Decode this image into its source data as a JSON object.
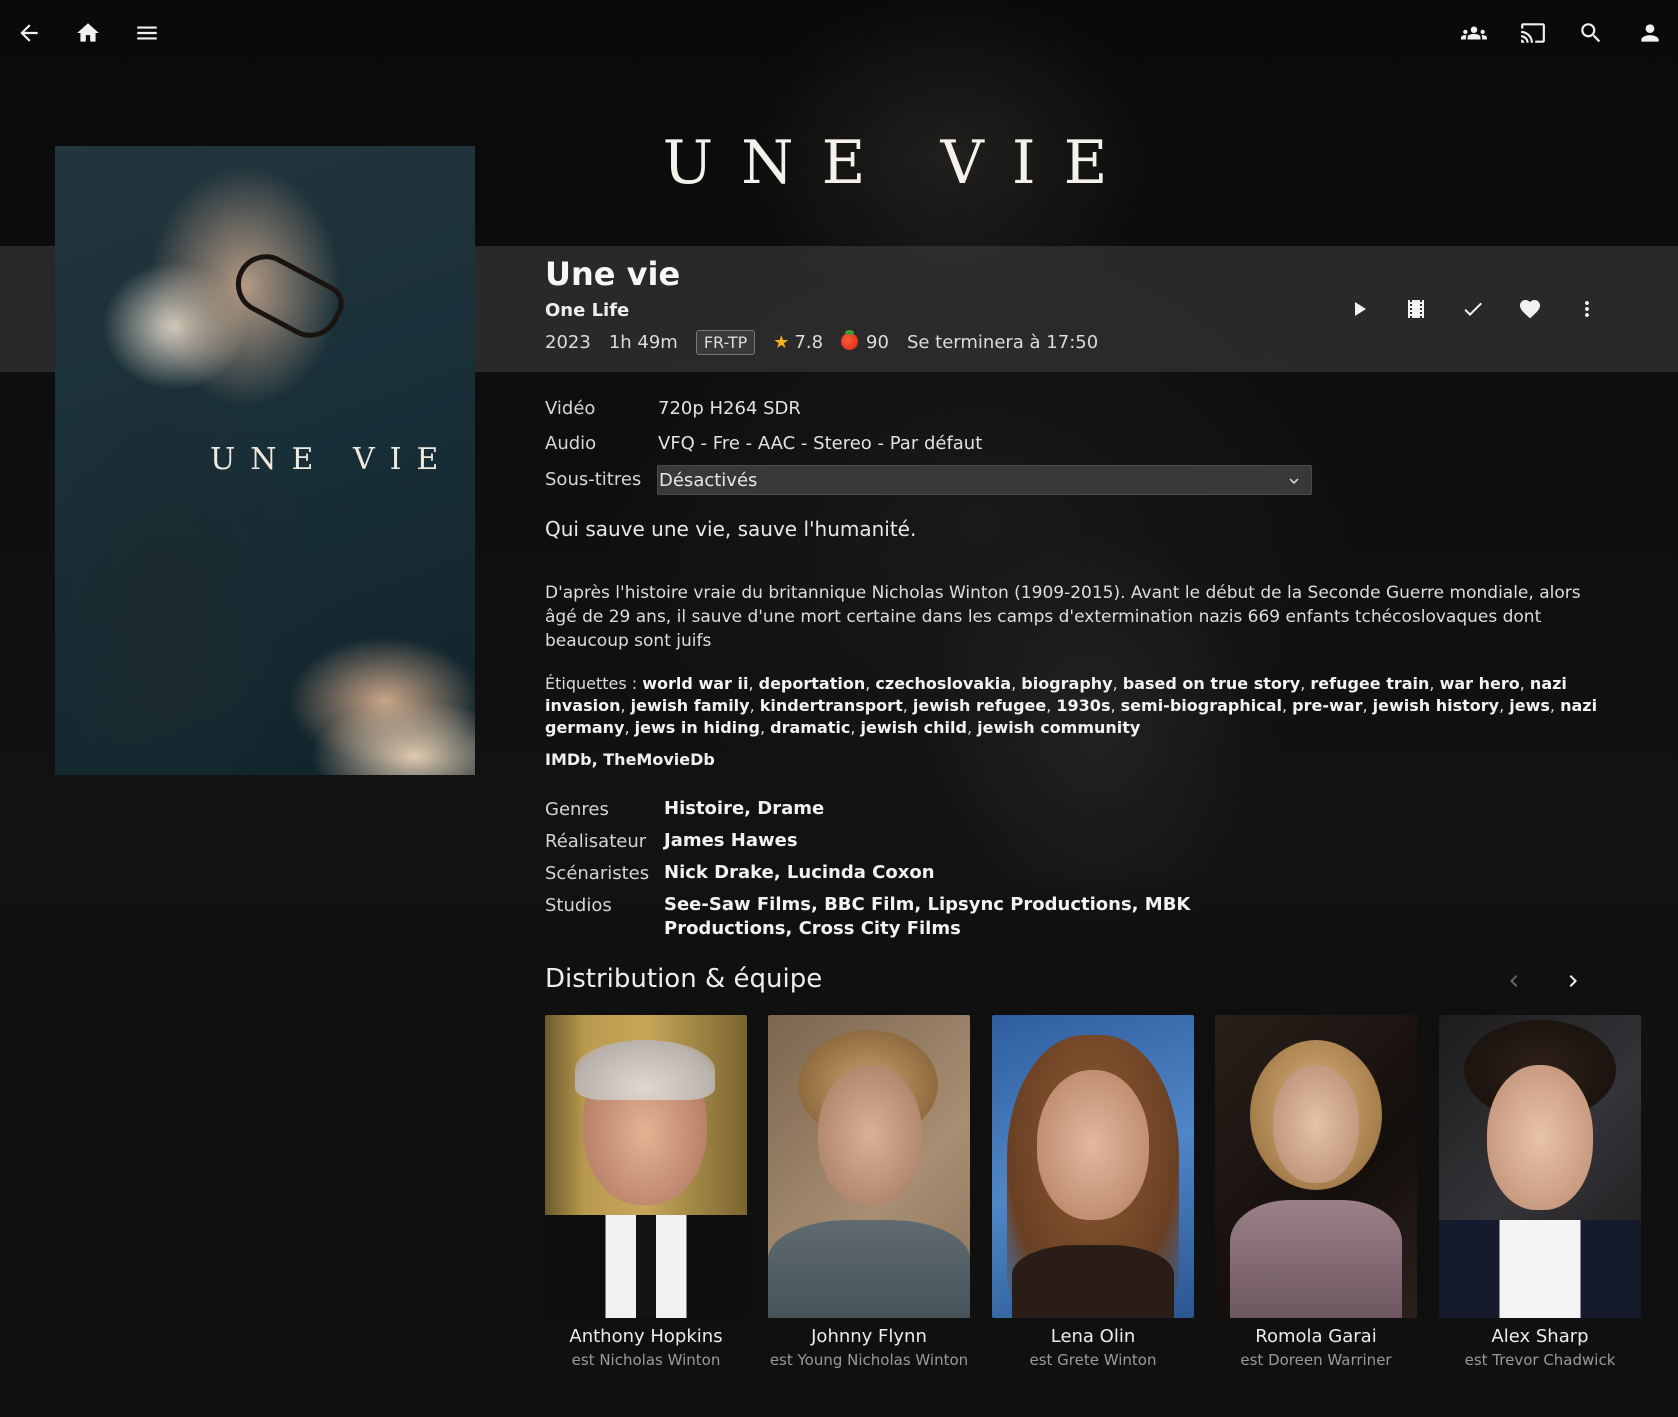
{
  "header": {
    "back_icon": "arrow-back-icon",
    "home_icon": "home-icon",
    "menu_icon": "menu-icon",
    "right_icons": [
      "group-icon",
      "cast-icon",
      "search-icon",
      "account-icon"
    ]
  },
  "backdrop_logo": "UNE VIE",
  "poster_title": "UNE VIE",
  "title": "Une vie",
  "original_title": "One Life",
  "meta": {
    "year": "2023",
    "runtime": "1h 49m",
    "official_rating": "FR-TP",
    "community_rating": "7.8",
    "critic_rating": "90",
    "ends_at": "Se terminera à 17:50"
  },
  "colors": {
    "star": "#f2b01e",
    "tomato": "#d3260e",
    "band": "#343434"
  },
  "actions": [
    "play-icon",
    "trailer-icon",
    "check-icon",
    "heart-icon",
    "more-vert-icon"
  ],
  "media_info": {
    "video_label": "Vidéo",
    "video_value": "720p H264 SDR",
    "audio_label": "Audio",
    "audio_value": "VFQ - Fre - AAC - Stereo - Par défaut",
    "subtitles_label": "Sous-titres",
    "subtitles_value": "Désactivés"
  },
  "tagline": "Qui sauve une vie, sauve l'humanité.",
  "overview": "D'après l'histoire vraie du britannique Nicholas Winton (1909-2015). Avant le début de la Seconde Guerre mondiale, alors âgé de 29 ans, il sauve d'une mort certaine dans les camps d'extermination nazis 669 enfants tchécoslovaques dont beaucoup sont juifs",
  "tags_label": "Étiquettes :",
  "tags": [
    "world war ii",
    "deportation",
    "czechoslovakia",
    "biography",
    "based on true story",
    "refugee train",
    "war hero",
    "nazi invasion",
    "jewish family",
    "kindertransport",
    "jewish refugee",
    "1930s",
    "semi-biographical",
    "pre-war",
    "jewish history",
    "jews",
    "nazi germany",
    "jews in hiding",
    "dramatic",
    "jewish child",
    "jewish community"
  ],
  "external_links": [
    "IMDb",
    "TheMovieDb"
  ],
  "credits": {
    "genres_label": "Genres",
    "genres": "Histoire, Drame",
    "director_label": "Réalisateur",
    "director": "James Hawes",
    "writers_label": "Scénaristes",
    "writers": "Nick Drake, Lucinda Coxon",
    "studios_label": "Studios",
    "studios": "See-Saw Films, BBC Film, Lipsync Productions, MBK Productions, Cross City Films"
  },
  "cast_section": {
    "title": "Distribution & équipe",
    "prev_icon": "chevron-left-icon",
    "next_icon": "chevron-right-icon",
    "people": [
      {
        "name": "Anthony Hopkins",
        "role": "est Nicholas Winton"
      },
      {
        "name": "Johnny Flynn",
        "role": "est Young Nicholas Winton"
      },
      {
        "name": "Lena Olin",
        "role": "est Grete Winton"
      },
      {
        "name": "Romola Garai",
        "role": "est Doreen Warriner"
      },
      {
        "name": "Alex Sharp",
        "role": "est Trevor Chadwick"
      }
    ]
  }
}
